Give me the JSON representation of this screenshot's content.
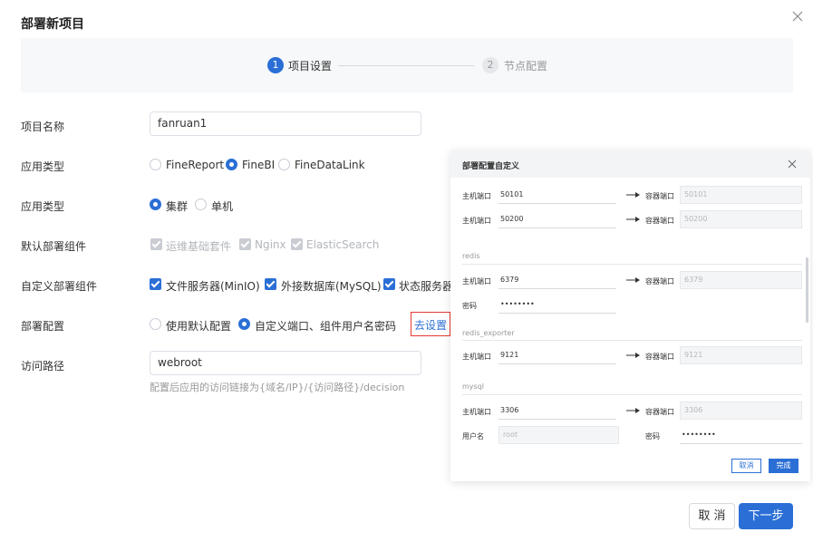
{
  "dialog": {
    "title": "部署新项目",
    "close_icon": "close-icon"
  },
  "steps": [
    {
      "num": "1",
      "label": "项目设置"
    },
    {
      "num": "2",
      "label": "节点配置"
    }
  ],
  "form": {
    "project_name": {
      "label": "项目名称",
      "value": "fanruan1"
    },
    "app_type": {
      "label": "应用类型",
      "options": [
        "FineReport",
        "FineBI",
        "FineDataLink"
      ],
      "selected": "FineBI"
    },
    "deploy_type": {
      "label": "应用类型",
      "options": [
        "集群",
        "单机"
      ],
      "selected": "集群"
    },
    "default_components": {
      "label": "默认部署组件",
      "items": [
        "运维基础套件",
        "Nginx",
        "ElasticSearch"
      ]
    },
    "custom_components": {
      "label": "自定义部署组件",
      "items": [
        "文件服务器(MinIO)",
        "外接数据库(MySQL)",
        "状态服务器"
      ]
    },
    "deploy_config": {
      "label": "部署配置",
      "options": [
        "使用默认配置",
        "自定义端口、组件用户名密码"
      ],
      "selected": "自定义端口、组件用户名密码",
      "goto_label": "去设置"
    },
    "access_path": {
      "label": "访问路径",
      "value": "webroot",
      "hint": "配置后应用的访问链接为{域名/IP}/{访问路径}/decision"
    }
  },
  "panel": {
    "title": "部署配置自定义",
    "host_port_label": "主机端口",
    "container_port_label": "容器端口",
    "password_label": "密码",
    "username_label": "用户名",
    "rows": [
      {
        "host": "50101",
        "container": "50101"
      },
      {
        "host": "50200",
        "container": "50200"
      }
    ],
    "redis": {
      "section": "redis",
      "host": "6379",
      "container": "6379",
      "password": "••••••••"
    },
    "redis_exporter": {
      "section": "redis_exporter",
      "host": "9121",
      "container": "9121"
    },
    "mysql": {
      "section": "mysql",
      "host": "3306",
      "container": "3306",
      "username": "root",
      "password": "••••••••"
    },
    "cancel_label": "取消",
    "done_label": "完成"
  },
  "footer": {
    "cancel_label": "取 消",
    "next_label": "下一步"
  },
  "colors": {
    "primary": "#2b6fd6",
    "highlight": "#e53935"
  }
}
